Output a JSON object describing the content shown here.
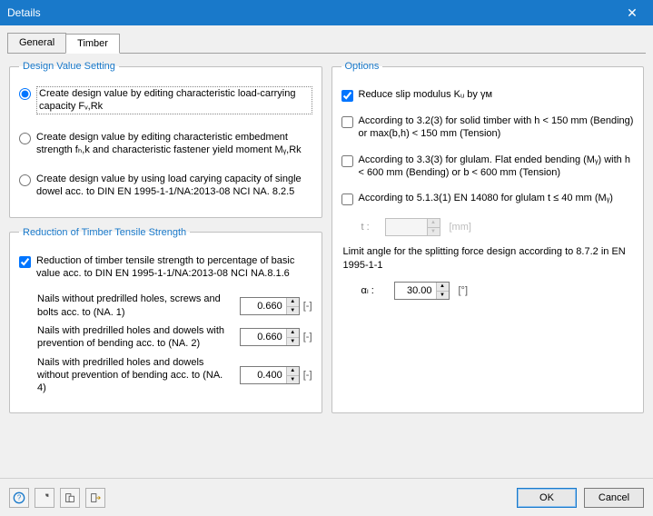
{
  "window": {
    "title": "Details"
  },
  "tabs": {
    "general": "General",
    "timber": "Timber",
    "active": "timber"
  },
  "design_value": {
    "legend": "Design Value Setting",
    "r1": "Create design value by editing characteristic load-carrying capacity Fᵥ,Rk",
    "r2": "Create design value by editing characteristic embedment strength fₕ,k and characteristic fastener yield moment Mᵧ,Rk",
    "r3": "Create design value by using load carying capacity of single dowel acc. to DIN EN 1995-1-1/NA:2013-08 NCI NA. 8.2.5",
    "selected": "r1"
  },
  "reduction": {
    "legend": "Reduction of Timber Tensile Strength",
    "cb": "Reduction of timber tensile strength to percentage of basic value acc. to DIN EN 1995-1-1/NA:2013-08 NCI NA.8.1.6",
    "cb_checked": true,
    "row1": {
      "label": "Nails without predrilled holes, screws and bolts acc. to (NA. 1)",
      "value": "0.660",
      "unit": "[-]"
    },
    "row2": {
      "label": "Nails with predrilled holes and dowels with prevention of bending acc. to (NA. 2)",
      "value": "0.660",
      "unit": "[-]"
    },
    "row3": {
      "label": "Nails with predrilled holes and dowels without prevention of bending acc. to (NA. 4)",
      "value": "0.400",
      "unit": "[-]"
    }
  },
  "options": {
    "legend": "Options",
    "o1": {
      "label": "Reduce slip modulus Kᵤ by γᴍ",
      "checked": true
    },
    "o2": {
      "label": "According to 3.2(3) for solid timber with h < 150 mm (Bending) or max(b,h) < 150 mm (Tension)",
      "checked": false
    },
    "o3": {
      "label": "According to 3.3(3) for glulam. Flat ended bending (Mᵧ) with h < 600 mm (Bending) or b < 600 mm (Tension)",
      "checked": false
    },
    "o4": {
      "label": "According to 5.1.3(1) EN 14080 for glulam t ≤ 40 mm (Mᵧ)",
      "checked": false
    },
    "t": {
      "label": "t :",
      "value": "",
      "unit": "[mm]"
    },
    "limit": "Limit angle for the splitting force design according to 8.7.2 in EN 1995-1-1",
    "alpha": {
      "label": "αₗ :",
      "value": "30.00",
      "unit": "[°]"
    }
  },
  "footer": {
    "ok": "OK",
    "cancel": "Cancel"
  }
}
